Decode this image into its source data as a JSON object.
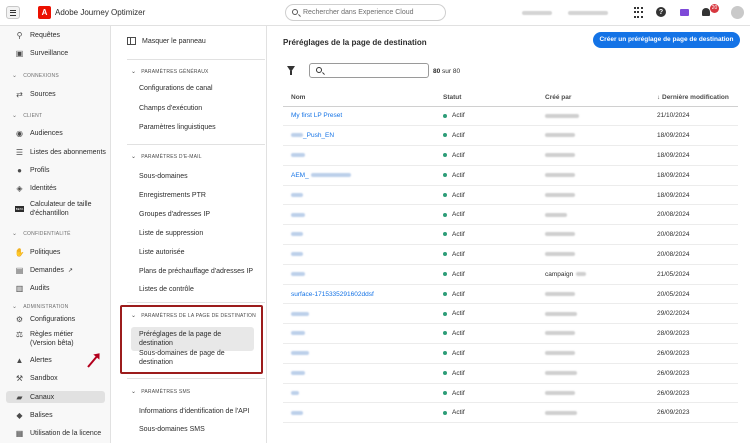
{
  "header": {
    "app_title": "Adobe Journey Optimizer",
    "search_placeholder": "Rechercher dans Experience Cloud",
    "logo_letter": "A",
    "notification_count": "20"
  },
  "leftnav": {
    "items_top": [
      {
        "label": "Requêtes",
        "icon": "query-icon"
      },
      {
        "label": "Surveillance",
        "icon": "monitor-icon"
      }
    ],
    "sections": {
      "connexions": "CONNEXIONS",
      "client": "CLIENT",
      "confidentialite": "CONFIDENTIALITÉ",
      "administration": "ADMINISTRATION"
    },
    "sources": "Sources",
    "audiences": "Audiences",
    "listes_abonnements": "Listes des abonnements",
    "profils": "Profils",
    "identites": "Identités",
    "calculateur_1": "Calculateur de taille",
    "calculateur_2": "d'échantillon",
    "politiques": "Politiques",
    "demandes": "Demandes",
    "audits": "Audits",
    "configurations": "Configurations",
    "regles_1": "Règles métier",
    "regles_2": "(Version bêta)",
    "alertes": "Alertes",
    "sandbox": "Sandbox",
    "canaux": "Canaux",
    "balises": "Balises",
    "utilisation": "Utilisation de la licence"
  },
  "panel": {
    "hide": "Masquer le panneau",
    "general_title": "PARAMÈTRES GÉNÉRAUX",
    "general_items": [
      "Configurations de canal",
      "Champs d'exécution",
      "Paramètres linguistiques"
    ],
    "email_title": "PARAMÈTRES D'E-MAIL",
    "email_items": [
      "Sous-domaines",
      "Enregistrements PTR",
      "Groupes d'adresses IP",
      "Liste de suppression",
      "Liste autorisée",
      "Plans de préchauffage d'adresses IP",
      "Listes de contrôle"
    ],
    "landing_title": "PARAMÈTRES DE LA PAGE DE DESTINATION",
    "landing_active": "Préréglages de la page de destination",
    "landing_sub_1": "Sous-domaines de page de",
    "landing_sub_2": "destination",
    "sms_title": "PARAMÈTRES SMS",
    "sms_items": [
      "Informations d'identification de l'API",
      "Sous-domaines SMS"
    ]
  },
  "main": {
    "title": "Préréglages de la page de destination",
    "create_button": "Créer un préréglage de page de destination",
    "count_shown": "80",
    "count_sep": "sur",
    "count_total": "80",
    "columns": {
      "name": "Nom",
      "status": "Statut",
      "created_by": "Créé par",
      "modified": "Dernière modification"
    },
    "rows": [
      {
        "name": "My first LP Preset",
        "status": "Actif",
        "created_by": "",
        "date": "21/10/2024"
      },
      {
        "name": "",
        "status": "Actif",
        "created_by": "",
        "date": "18/09/2024"
      },
      {
        "name": "",
        "status": "Actif",
        "created_by": "",
        "date": "18/09/2024"
      },
      {
        "name": "AEM_",
        "status": "Actif",
        "created_by": "",
        "date": "18/09/2024"
      },
      {
        "name": "",
        "status": "Actif",
        "created_by": "",
        "date": "18/09/2024"
      },
      {
        "name": "",
        "status": "Actif",
        "created_by": "",
        "date": "20/08/2024"
      },
      {
        "name": "",
        "status": "Actif",
        "created_by": "",
        "date": "20/08/2024"
      },
      {
        "name": "",
        "status": "Actif",
        "created_by": "",
        "date": "20/08/2024"
      },
      {
        "name": "",
        "status": "Actif",
        "created_by": "campaign",
        "date": "21/05/2024"
      },
      {
        "name": "surface-1715335291602ddsf",
        "status": "Actif",
        "created_by": "",
        "date": "20/05/2024"
      },
      {
        "name": "",
        "status": "Actif",
        "created_by": "",
        "date": "29/02/2024"
      },
      {
        "name": "",
        "status": "Actif",
        "created_by": "",
        "date": "28/09/2023"
      },
      {
        "name": "",
        "status": "Actif",
        "created_by": "",
        "date": "26/09/2023"
      },
      {
        "name": "",
        "status": "Actif",
        "created_by": "",
        "date": "26/09/2023"
      },
      {
        "name": "",
        "status": "Actif",
        "created_by": "",
        "date": "26/09/2023"
      },
      {
        "name": "",
        "status": "Actif",
        "created_by": "",
        "date": "26/09/2023"
      }
    ]
  },
  "colors": {
    "accent": "#1473e6",
    "status_active": "#2d9d78",
    "highlight_border": "#9c1c1c",
    "brand": "#eb1000"
  }
}
